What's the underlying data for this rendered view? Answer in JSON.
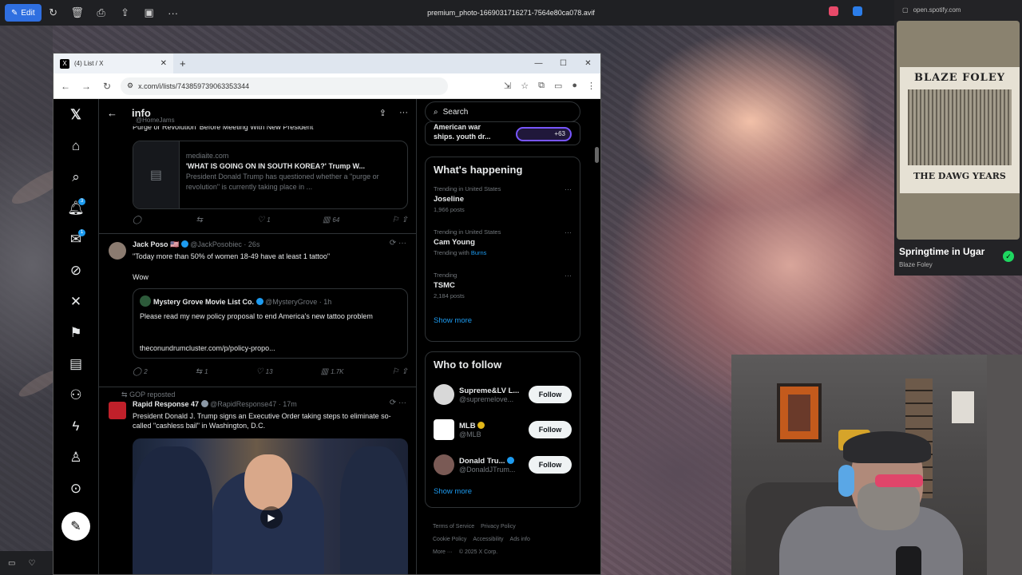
{
  "viewer": {
    "edit_label": "Edit",
    "file_title": "premium_photo-1669031716271-7564e80ca078.avif"
  },
  "browser": {
    "tab_title": "(4) List / X",
    "url": "x.com/i/lists/743859739063353344"
  },
  "timeline": {
    "title": "info",
    "handle": "@HomeJams",
    "prev_post_snippet": "Purge or Revolution' Before Meeting With New President",
    "link_card": {
      "domain": "mediaite.com",
      "headline": "'WHAT IS GOING ON IN SOUTH KOREA?' Trump W...",
      "description": "President Donald Trump has questioned whether a \"purge or revolution\" is currently taking place in ..."
    },
    "actions1": {
      "replies": "",
      "reposts": "",
      "likes": "1",
      "views": "64"
    },
    "post2": {
      "author": "Jack Poso 🇺🇸",
      "handle": "@JackPosobiec · 26s",
      "text": "\"Today more than 50% of women 18-49 have at least 1 tattoo\"",
      "text2": "Wow",
      "quote": {
        "author": "Mystery Grove Movie List Co.",
        "handle": "@MysteryGrove · 1h",
        "text": "Please read my new policy proposal to end America's new tattoo problem",
        "link": "theconundrumcluster.com/p/policy-propo..."
      },
      "actions": {
        "replies": "2",
        "reposts": "1",
        "likes": "13",
        "views": "1.7K"
      }
    },
    "post3": {
      "repost_label": "GOP reposted",
      "author": "Rapid Response 47",
      "handle": "@RapidResponse47 · 17m",
      "text": "President Donald J. Trump signs an Executive Order taking steps to eliminate so-called \"cashless bail\" in Washington, D.C."
    }
  },
  "sidebar": {
    "search_placeholder": "Search",
    "spaces_line1": "American war",
    "spaces_line2": "ships.  youth dr...",
    "spaces_count": "+63",
    "happening_title": "What's happening",
    "trends": [
      {
        "context": "Trending in United States",
        "name": "Joseline",
        "posts": "1,966 posts",
        "with_prefix": "",
        "with_link": ""
      },
      {
        "context": "Trending in United States",
        "name": "Cam Young",
        "posts": "",
        "with_prefix": "Trending with",
        "with_link": "Burns"
      },
      {
        "context": "Trending",
        "name": "TSMC",
        "posts": "2,184 posts",
        "with_prefix": "",
        "with_link": ""
      }
    ],
    "show_more": "Show more",
    "who_to_follow_title": "Who to follow",
    "follow_suggestions": [
      {
        "name": "Supreme&LV L...",
        "handle": "@supremelove...",
        "button": "Follow",
        "color": "#d8d8d8"
      },
      {
        "name": "MLB",
        "handle": "@MLB",
        "button": "Follow",
        "color": "#ffffff"
      },
      {
        "name": "Donald Tru...",
        "handle": "@DonaldJTrum...",
        "button": "Follow",
        "color": "#7a5a55"
      }
    ],
    "show_more2": "Show more",
    "footer": [
      "Terms of Service",
      "Privacy Policy",
      "Cookie Policy",
      "Accessibility",
      "Ads info",
      "More ···",
      "© 2025 X Corp."
    ]
  },
  "spotify": {
    "url": "open.spotify.com",
    "album_top": "BLAZE FOLEY",
    "album_bottom": "THE DAWG YEARS",
    "track": "Springtime in Ugar",
    "artist": "Blaze Foley"
  },
  "colors": {
    "accent": "#1d9bf0",
    "x_bg": "#000000",
    "spotify_green": "#1ed760"
  }
}
